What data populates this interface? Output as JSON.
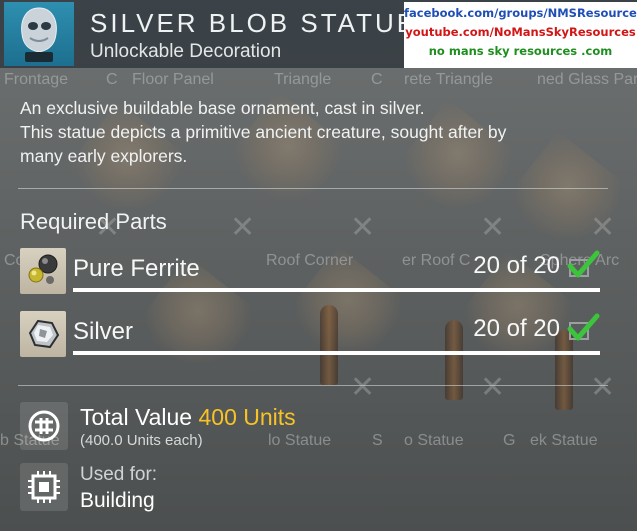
{
  "header": {
    "title": "SILVER BLOB STATUE",
    "subtitle": "Unlockable Decoration",
    "thumbnail_icon": "silver-blob-statue-icon"
  },
  "watermark": {
    "line1": "facebook.com/groups/NMSResources",
    "line2": "youtube.com/NoMansSkyResources",
    "line3": "no mans sky resources .com"
  },
  "background_labels": [
    "Frontage",
    "C",
    "Floor Panel",
    "Triangle",
    "C",
    "rete Triangle",
    "ned Glass Par",
    "Co",
    "Roof Corner",
    "er Roof C",
    "Sphere Arc",
    "b Statue",
    "lo Statue",
    "S",
    "o Statue",
    "G",
    "ek Statue"
  ],
  "description": {
    "line1": "An exclusive buildable base ornament, cast in silver.",
    "line2": "This statue depicts a primitive ancient creature, sought after by",
    "line3": "many early explorers."
  },
  "required_parts": {
    "title": "Required Parts",
    "items": [
      {
        "name": "Pure Ferrite",
        "count": "20 of 20",
        "progress": 1.0,
        "icon": "pure-ferrite-icon"
      },
      {
        "name": "Silver",
        "count": "20 of 20",
        "progress": 1.0,
        "icon": "silver-icon"
      }
    ]
  },
  "total": {
    "label": "Total Value",
    "value": "400 Units",
    "each": "(400.0 Units each)",
    "icon": "units-icon"
  },
  "used_for": {
    "label": "Used for:",
    "value": "Building",
    "icon": "building-chip-icon"
  },
  "colors": {
    "accent_value": "#f7c325",
    "check": "#3cc43c",
    "thumb_bg": "#2e8fb0"
  }
}
